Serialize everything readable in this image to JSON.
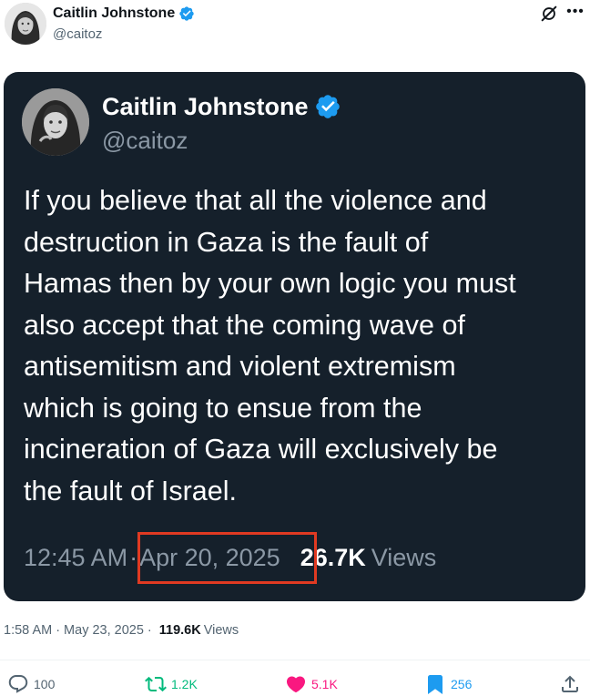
{
  "outer_tweet": {
    "author_name": "Caitlin Johnstone",
    "author_handle": "@caitoz",
    "time": "1:58 AM",
    "date": "May 23, 2025",
    "views_count": "119.6K",
    "views_label": "Views"
  },
  "quoted_tweet": {
    "author_name": "Caitlin Johnstone",
    "author_handle": "@caitoz",
    "text": "If you believe that all the violence and\ndestruction in Gaza is the fault of\nHamas then by your own logic you must\nalso accept that the coming wave of\nantisemitism and violent extremism\nwhich is going to ensue from the\nincineration of Gaza will exclusively be\nthe fault of Israel.",
    "time": "12:45 AM",
    "date": "Apr 20, 2025",
    "views_count": "26.7K",
    "views_label": "Views"
  },
  "actions": {
    "replies": "100",
    "reposts": "1.2K",
    "likes": "5.1K",
    "bookmarks": "256"
  },
  "colors": {
    "card_background": "#15202b",
    "verified": "#1d9bf0",
    "highlight_box": "#e03a22",
    "repost_active": "#00ba7c",
    "like_active": "#f91880",
    "bookmark_active": "#1d9bf0"
  },
  "icons": [
    "verified-badge-icon",
    "grok-icon",
    "more-icon",
    "reply-icon",
    "repost-icon",
    "like-icon",
    "bookmark-icon",
    "share-icon"
  ]
}
